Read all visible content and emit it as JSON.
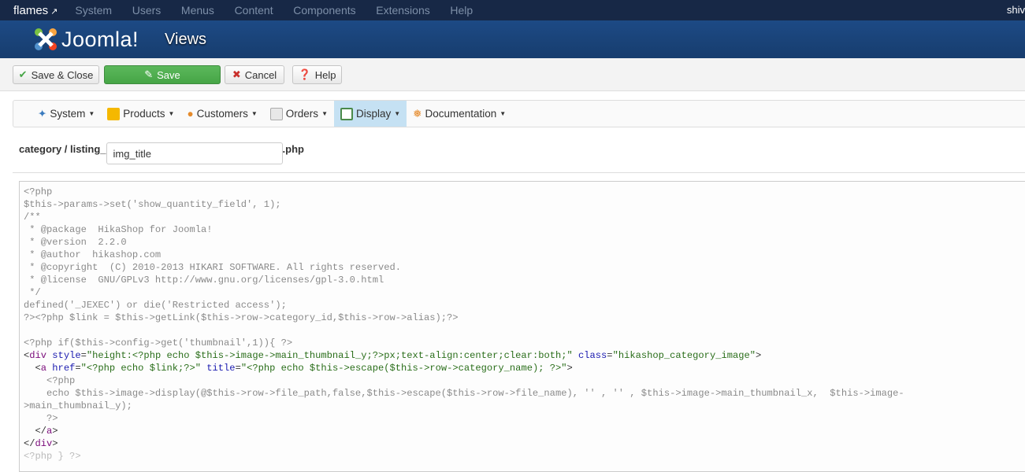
{
  "topbar": {
    "site": "flames",
    "menu": [
      "System",
      "Users",
      "Menus",
      "Content",
      "Components",
      "Extensions",
      "Help"
    ],
    "user": "shiv"
  },
  "header": {
    "logo": "Joomla!",
    "title": "Views"
  },
  "toolbar": {
    "save_close": "Save & Close",
    "save": "Save",
    "cancel": "Cancel",
    "help": "Help"
  },
  "submenu": [
    "System",
    "Products",
    "Customers",
    "Orders",
    "Display",
    "Documentation"
  ],
  "file": {
    "prefix": "category / listing_",
    "value": "img_title",
    "suffix": ".php"
  },
  "colors": {
    "topbar": "#172846",
    "header": "#1d4a85",
    "save": "#5cb85c",
    "active": "#c5e1f3"
  },
  "code": [
    [
      {
        "t": "<?php",
        "c": "g"
      }
    ],
    [
      {
        "t": "$this->params->set('show_quantity_field', 1);",
        "c": "g"
      }
    ],
    [
      {
        "t": "/**",
        "c": "g"
      }
    ],
    [
      {
        "t": " * @package  HikaShop for Joomla!",
        "c": "g"
      }
    ],
    [
      {
        "t": " * @version  2.2.0",
        "c": "g"
      }
    ],
    [
      {
        "t": " * @author  hikashop.com",
        "c": "g"
      }
    ],
    [
      {
        "t": " * @copyright  (C) 2010-2013 HIKARI SOFTWARE. All rights reserved.",
        "c": "g"
      }
    ],
    [
      {
        "t": " * @license  GNU/GPLv3 http://www.gnu.org/licenses/gpl-3.0.html",
        "c": "g"
      }
    ],
    [
      {
        "t": " */",
        "c": "g"
      }
    ],
    [
      {
        "t": "defined('_JEXEC') or die('Restricted access');",
        "c": "g"
      }
    ],
    [
      {
        "t": "?><?php $link = $this->getLink($this->row->category_id,$this->row->alias);?>",
        "c": "g"
      }
    ],
    [
      {
        "t": "",
        "c": "g"
      }
    ],
    [
      {
        "t": "<?php if($this->config->get('thumbnail',1)){ ?>",
        "c": "g"
      }
    ],
    [
      {
        "t": "<",
        "c": "d"
      },
      {
        "t": "div",
        "c": "tag"
      },
      {
        "t": " style",
        "c": "attr"
      },
      {
        "t": "=",
        "c": "d"
      },
      {
        "t": "\"height:<?php echo $this->image->main_thumbnail_y;?>px;text-align:center;clear:both;\"",
        "c": "str"
      },
      {
        "t": " class",
        "c": "attr"
      },
      {
        "t": "=",
        "c": "d"
      },
      {
        "t": "\"hikashop_category_image\"",
        "c": "str"
      },
      {
        "t": ">",
        "c": "d"
      }
    ],
    [
      {
        "t": "  <",
        "c": "d"
      },
      {
        "t": "a",
        "c": "tag"
      },
      {
        "t": " href",
        "c": "attr"
      },
      {
        "t": "=",
        "c": "d"
      },
      {
        "t": "\"<?php echo $link;?>\"",
        "c": "str"
      },
      {
        "t": " title",
        "c": "attr"
      },
      {
        "t": "=",
        "c": "d"
      },
      {
        "t": "\"<?php echo $this->escape($this->row->category_name); ?>\"",
        "c": "str"
      },
      {
        "t": ">",
        "c": "d"
      }
    ],
    [
      {
        "t": "    <?php",
        "c": "g"
      }
    ],
    [
      {
        "t": "    echo $this->image->display(@$this->row->file_path,false,$this->escape($this->row->file_name), '' , '' , $this->image->main_thumbnail_x,  $this->image-",
        "c": "g"
      }
    ],
    [
      {
        "t": ">main_thumbnail_y);",
        "c": "g"
      }
    ],
    [
      {
        "t": "    ?>",
        "c": "g"
      }
    ],
    [
      {
        "t": "  </",
        "c": "d"
      },
      {
        "t": "a",
        "c": "tag"
      },
      {
        "t": ">",
        "c": "d"
      }
    ],
    [
      {
        "t": "</",
        "c": "d"
      },
      {
        "t": "div",
        "c": "tag"
      },
      {
        "t": ">",
        "c": "d"
      }
    ],
    [
      {
        "t": "<?php } ?>",
        "c": "lg"
      }
    ]
  ]
}
